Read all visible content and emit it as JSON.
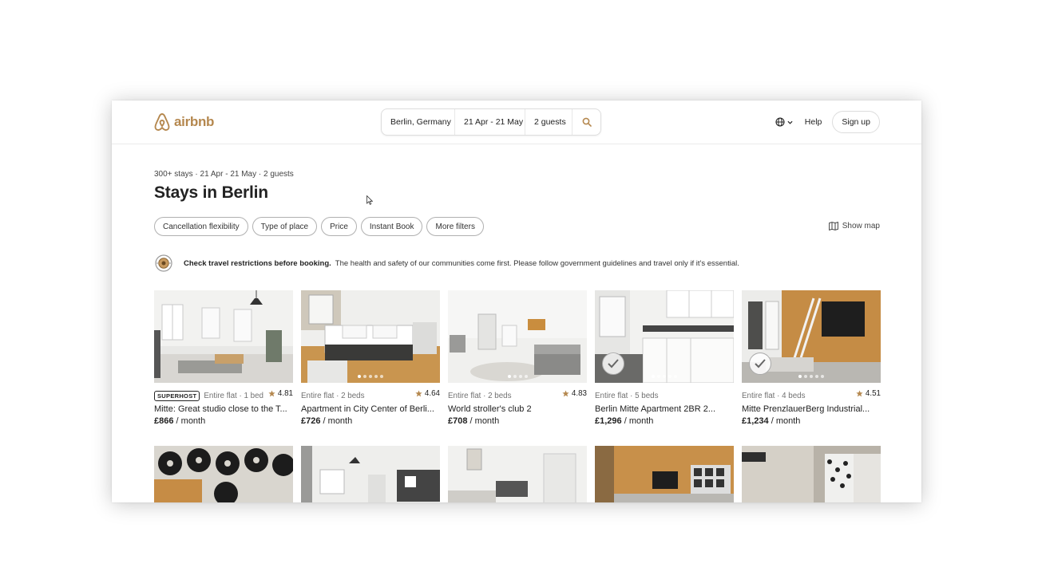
{
  "header": {
    "logo_text": "airbnb",
    "search": {
      "location": "Berlin, Germany",
      "dates": "21 Apr - 21 May",
      "guests": "2 guests"
    },
    "help_label": "Help",
    "signup_label": "Sign up"
  },
  "results": {
    "meta": "300+ stays · 21 Apr - 21 May · 2 guests",
    "title": "Stays in Berlin"
  },
  "filters": [
    "Cancellation flexibility",
    "Type of place",
    "Price",
    "Instant Book",
    "More filters"
  ],
  "show_map_label": "Show map",
  "notice": {
    "bold": "Check travel restrictions before booking.",
    "text": "The health and safety of our communities come first. Please follow government guidelines and travel only if it's essential."
  },
  "listings": [
    {
      "superhost_label": "SUPERHOST",
      "type": "Entire flat · 1 bed",
      "rating": "4.81",
      "title": "Mitte: Great studio close to the T...",
      "price": "£866",
      "period": " / month"
    },
    {
      "type": "Entire flat · 2 beds",
      "rating": "4.64",
      "title": "Apartment in City Center of Berli...",
      "price": "£726",
      "period": " / month"
    },
    {
      "type": "Entire flat · 2 beds",
      "rating": "4.83",
      "title": "World stroller's club 2",
      "price": "£708",
      "period": " / month"
    },
    {
      "type": "Entire flat · 5 beds",
      "title": "Berlin Mitte Apartment 2BR 2...",
      "price": "£1,296",
      "period": " / month"
    },
    {
      "type": "Entire flat · 4 beds",
      "rating": "4.51",
      "title": "Mitte PrenzlauerBerg Industrial...",
      "price": "£1,234",
      "period": " / month"
    }
  ],
  "colors": {
    "brand": "#b5884f",
    "text": "#222222",
    "muted": "#717171",
    "border": "#dddddd"
  },
  "icons": [
    "airbnb-logo-icon",
    "search-icon",
    "globe-icon",
    "chevron-down-icon",
    "map-icon",
    "warning-notice-icon",
    "star-icon",
    "check-icon",
    "mouse-cursor-icon"
  ]
}
